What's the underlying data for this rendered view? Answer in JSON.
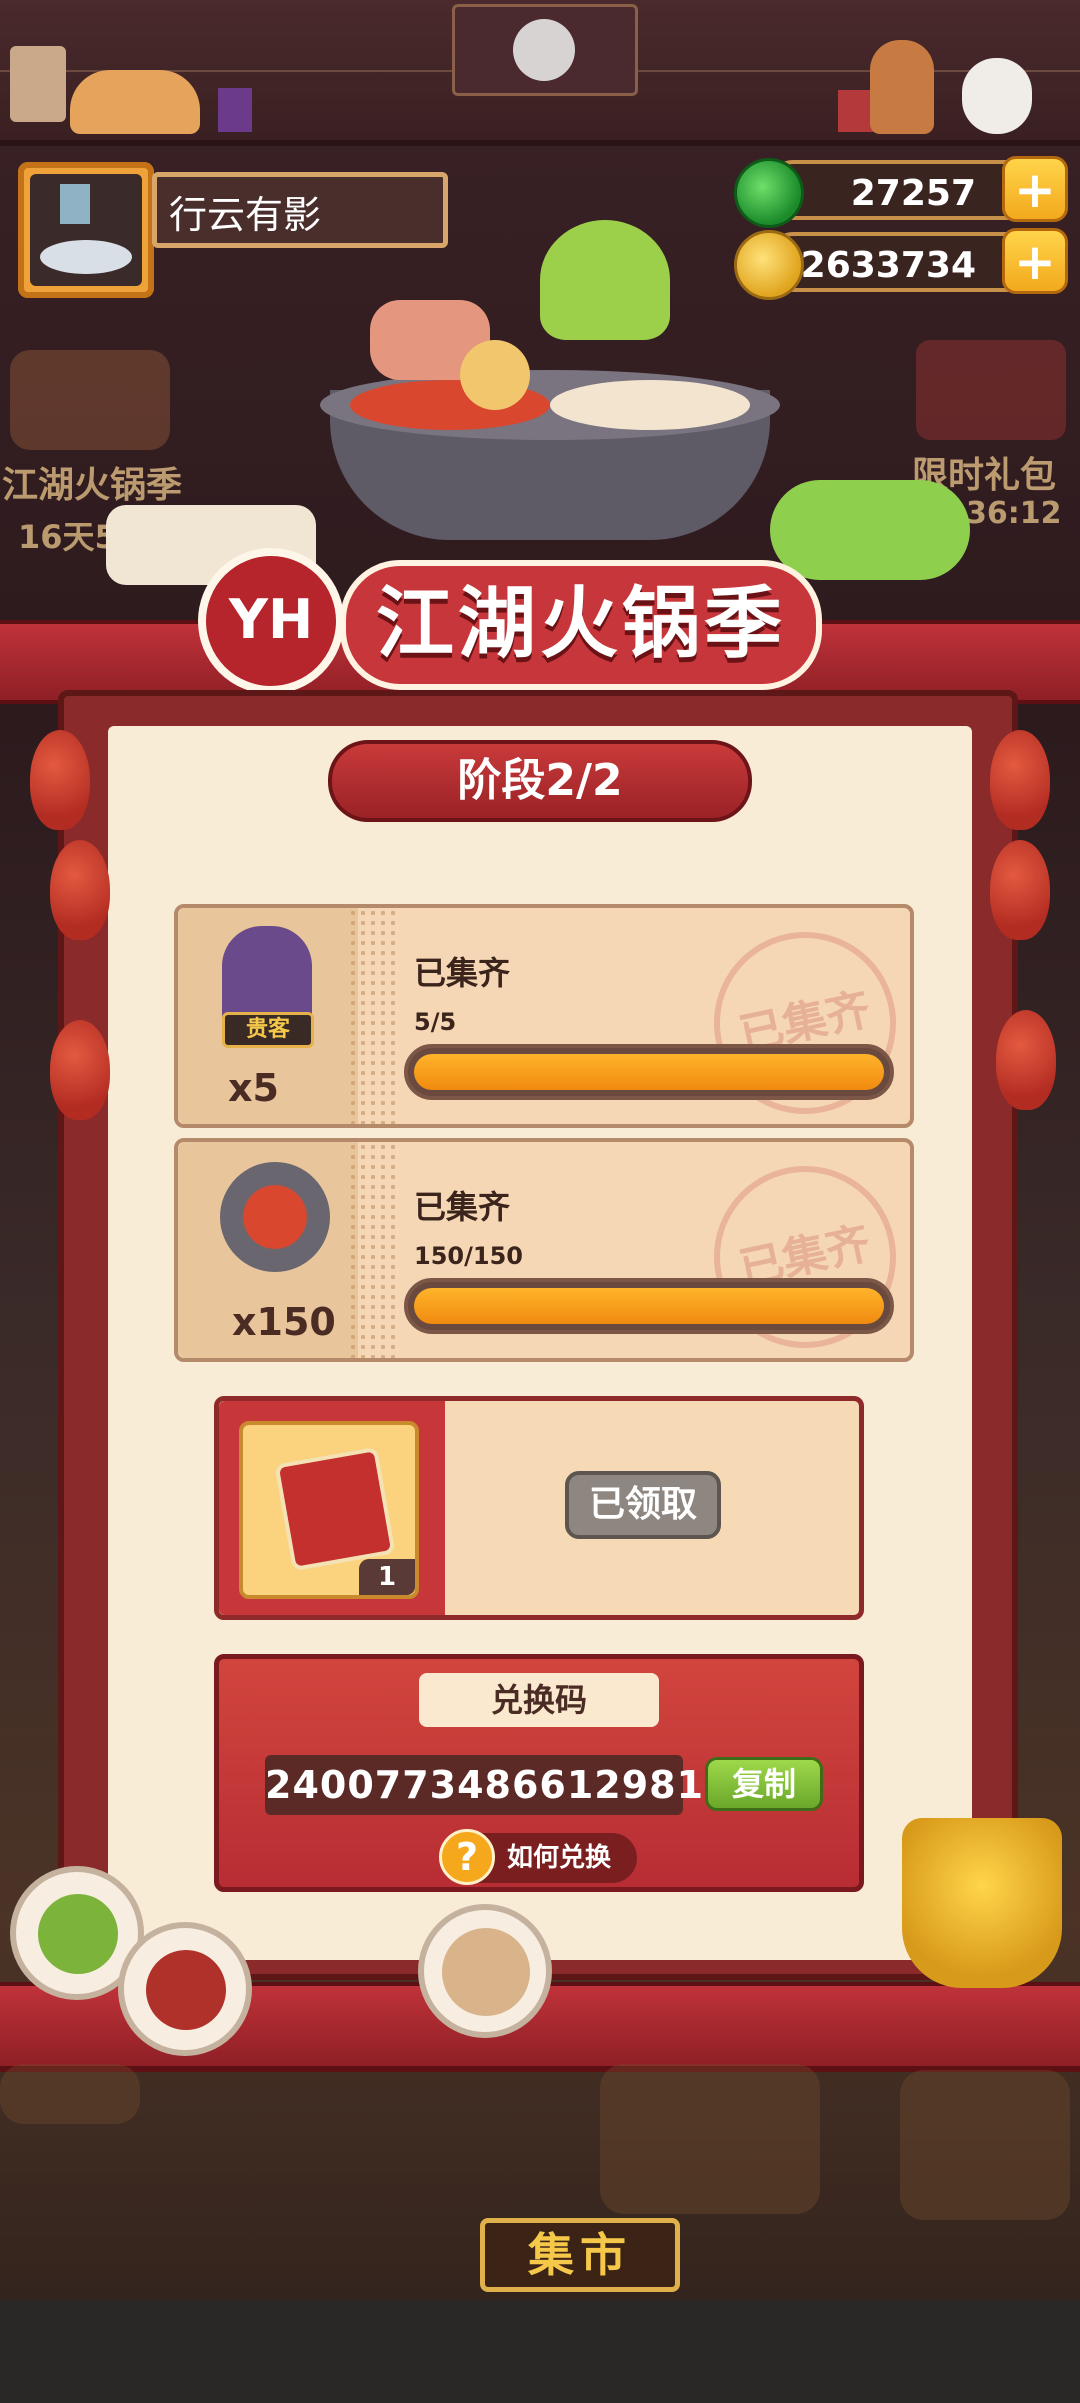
{
  "player": {
    "name": "行云有影"
  },
  "currency": {
    "jade": "27257",
    "coins": "22633734"
  },
  "event": {
    "title": "江湖火锅季",
    "badge": "YH",
    "stage": "阶段2/2"
  },
  "tasks": [
    {
      "status": "已集齐",
      "progress_text": "5/5",
      "progress": 1.0,
      "count": "x5",
      "tag": "贵客",
      "stamp": "已集齐"
    },
    {
      "status": "已集齐",
      "progress_text": "150/150",
      "progress": 1.0,
      "count": "x150",
      "stamp": "已集齐"
    }
  ],
  "reward": {
    "qty": "1",
    "button": "已领取"
  },
  "redeem": {
    "label": "兑换码",
    "code": "2400773486612981",
    "copy": "复制",
    "howto": "如何兑换"
  },
  "background": {
    "left_event": "江湖火锅季",
    "left_timer": "16天5",
    "right_event": "限时礼包",
    "right_timer": "36:12",
    "market": "集市"
  },
  "colors": {
    "accent_red": "#c7363a",
    "progress": "#f59a18",
    "panel": "#f9ecd6"
  }
}
